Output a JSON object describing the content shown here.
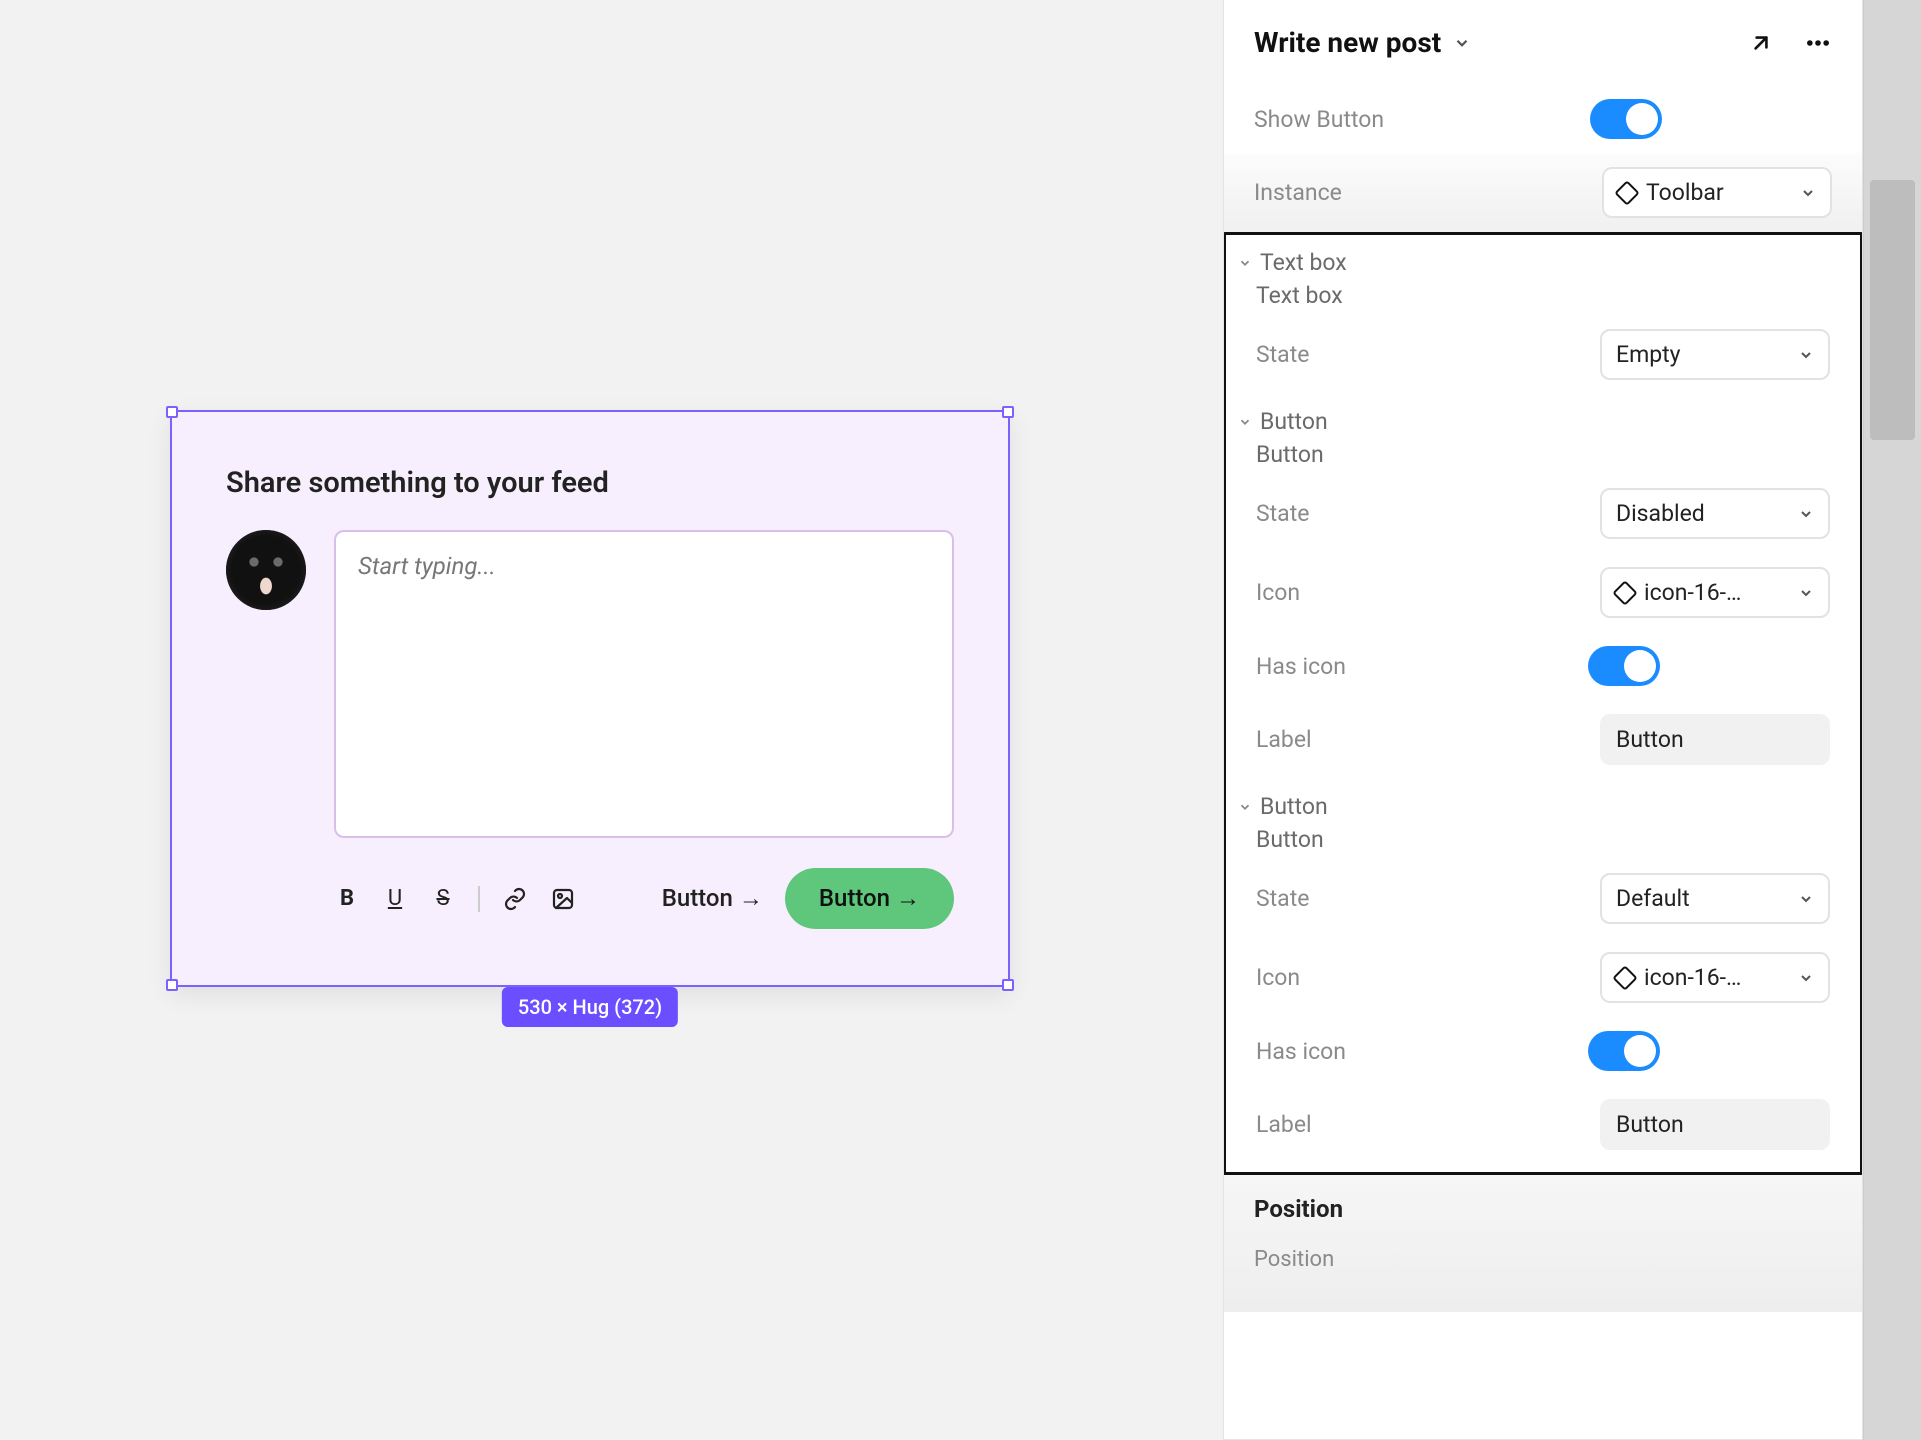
{
  "canvas": {
    "card_title": "Share something to your feed",
    "textbox_placeholder": "Start typing...",
    "ghost_button_label": "Button →",
    "primary_button_label": "Button →",
    "size_badge": "530 × Hug (372)"
  },
  "inspector": {
    "title": "Write new post",
    "show_button_label": "Show Button",
    "show_button_value": true,
    "instance_label": "Instance",
    "instance_value": "Toolbar",
    "groups": {
      "textbox": {
        "header": "Text box",
        "child": "Text box",
        "state_label": "State",
        "state_value": "Empty"
      },
      "button1": {
        "header": "Button",
        "child": "Button",
        "state_label": "State",
        "state_value": "Disabled",
        "icon_label": "Icon",
        "icon_value": "icon-16-…",
        "hasicon_label": "Has icon",
        "hasicon_value": true,
        "label_label": "Label",
        "label_value": "Button"
      },
      "button2": {
        "header": "Button",
        "child": "Button",
        "state_label": "State",
        "state_value": "Default",
        "icon_label": "Icon",
        "icon_value": "icon-16-…",
        "hasicon_label": "Has icon",
        "hasicon_value": true,
        "label_label": "Label",
        "label_value": "Button"
      }
    },
    "position_section_title": "Position",
    "position_sub_label": "Position"
  }
}
